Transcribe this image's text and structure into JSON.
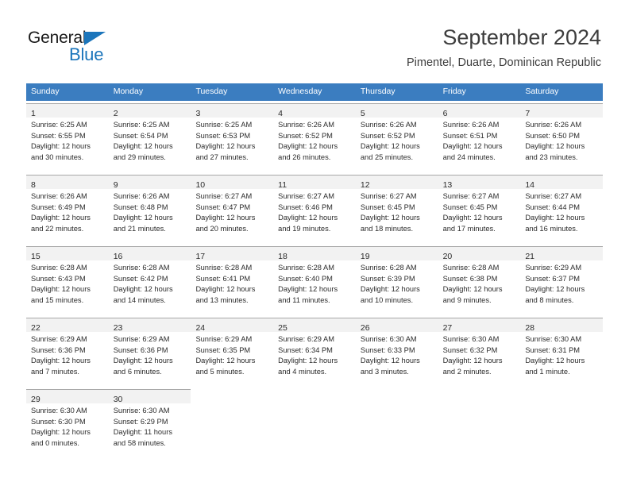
{
  "logo": {
    "word_dark": "General",
    "word_blue": "Blue",
    "accent_color": "#1b75bb"
  },
  "header": {
    "title": "September 2024",
    "subtitle": "Pimentel, Duarte, Dominican Republic"
  },
  "theme": {
    "weekday_header_bg": "#3b7dc0",
    "day_band_bg": "#f2f2f2",
    "cell_border": "#a8a8a8",
    "text_color": "#2b2b2b"
  },
  "weekdays": [
    "Sunday",
    "Monday",
    "Tuesday",
    "Wednesday",
    "Thursday",
    "Friday",
    "Saturday"
  ],
  "weeks": [
    [
      {
        "day": "1",
        "sunrise": "Sunrise: 6:25 AM",
        "sunset": "Sunset: 6:55 PM",
        "daylight_1": "Daylight: 12 hours",
        "daylight_2": "and 30 minutes."
      },
      {
        "day": "2",
        "sunrise": "Sunrise: 6:25 AM",
        "sunset": "Sunset: 6:54 PM",
        "daylight_1": "Daylight: 12 hours",
        "daylight_2": "and 29 minutes."
      },
      {
        "day": "3",
        "sunrise": "Sunrise: 6:25 AM",
        "sunset": "Sunset: 6:53 PM",
        "daylight_1": "Daylight: 12 hours",
        "daylight_2": "and 27 minutes."
      },
      {
        "day": "4",
        "sunrise": "Sunrise: 6:26 AM",
        "sunset": "Sunset: 6:52 PM",
        "daylight_1": "Daylight: 12 hours",
        "daylight_2": "and 26 minutes."
      },
      {
        "day": "5",
        "sunrise": "Sunrise: 6:26 AM",
        "sunset": "Sunset: 6:52 PM",
        "daylight_1": "Daylight: 12 hours",
        "daylight_2": "and 25 minutes."
      },
      {
        "day": "6",
        "sunrise": "Sunrise: 6:26 AM",
        "sunset": "Sunset: 6:51 PM",
        "daylight_1": "Daylight: 12 hours",
        "daylight_2": "and 24 minutes."
      },
      {
        "day": "7",
        "sunrise": "Sunrise: 6:26 AM",
        "sunset": "Sunset: 6:50 PM",
        "daylight_1": "Daylight: 12 hours",
        "daylight_2": "and 23 minutes."
      }
    ],
    [
      {
        "day": "8",
        "sunrise": "Sunrise: 6:26 AM",
        "sunset": "Sunset: 6:49 PM",
        "daylight_1": "Daylight: 12 hours",
        "daylight_2": "and 22 minutes."
      },
      {
        "day": "9",
        "sunrise": "Sunrise: 6:26 AM",
        "sunset": "Sunset: 6:48 PM",
        "daylight_1": "Daylight: 12 hours",
        "daylight_2": "and 21 minutes."
      },
      {
        "day": "10",
        "sunrise": "Sunrise: 6:27 AM",
        "sunset": "Sunset: 6:47 PM",
        "daylight_1": "Daylight: 12 hours",
        "daylight_2": "and 20 minutes."
      },
      {
        "day": "11",
        "sunrise": "Sunrise: 6:27 AM",
        "sunset": "Sunset: 6:46 PM",
        "daylight_1": "Daylight: 12 hours",
        "daylight_2": "and 19 minutes."
      },
      {
        "day": "12",
        "sunrise": "Sunrise: 6:27 AM",
        "sunset": "Sunset: 6:45 PM",
        "daylight_1": "Daylight: 12 hours",
        "daylight_2": "and 18 minutes."
      },
      {
        "day": "13",
        "sunrise": "Sunrise: 6:27 AM",
        "sunset": "Sunset: 6:45 PM",
        "daylight_1": "Daylight: 12 hours",
        "daylight_2": "and 17 minutes."
      },
      {
        "day": "14",
        "sunrise": "Sunrise: 6:27 AM",
        "sunset": "Sunset: 6:44 PM",
        "daylight_1": "Daylight: 12 hours",
        "daylight_2": "and 16 minutes."
      }
    ],
    [
      {
        "day": "15",
        "sunrise": "Sunrise: 6:28 AM",
        "sunset": "Sunset: 6:43 PM",
        "daylight_1": "Daylight: 12 hours",
        "daylight_2": "and 15 minutes."
      },
      {
        "day": "16",
        "sunrise": "Sunrise: 6:28 AM",
        "sunset": "Sunset: 6:42 PM",
        "daylight_1": "Daylight: 12 hours",
        "daylight_2": "and 14 minutes."
      },
      {
        "day": "17",
        "sunrise": "Sunrise: 6:28 AM",
        "sunset": "Sunset: 6:41 PM",
        "daylight_1": "Daylight: 12 hours",
        "daylight_2": "and 13 minutes."
      },
      {
        "day": "18",
        "sunrise": "Sunrise: 6:28 AM",
        "sunset": "Sunset: 6:40 PM",
        "daylight_1": "Daylight: 12 hours",
        "daylight_2": "and 11 minutes."
      },
      {
        "day": "19",
        "sunrise": "Sunrise: 6:28 AM",
        "sunset": "Sunset: 6:39 PM",
        "daylight_1": "Daylight: 12 hours",
        "daylight_2": "and 10 minutes."
      },
      {
        "day": "20",
        "sunrise": "Sunrise: 6:28 AM",
        "sunset": "Sunset: 6:38 PM",
        "daylight_1": "Daylight: 12 hours",
        "daylight_2": "and 9 minutes."
      },
      {
        "day": "21",
        "sunrise": "Sunrise: 6:29 AM",
        "sunset": "Sunset: 6:37 PM",
        "daylight_1": "Daylight: 12 hours",
        "daylight_2": "and 8 minutes."
      }
    ],
    [
      {
        "day": "22",
        "sunrise": "Sunrise: 6:29 AM",
        "sunset": "Sunset: 6:36 PM",
        "daylight_1": "Daylight: 12 hours",
        "daylight_2": "and 7 minutes."
      },
      {
        "day": "23",
        "sunrise": "Sunrise: 6:29 AM",
        "sunset": "Sunset: 6:36 PM",
        "daylight_1": "Daylight: 12 hours",
        "daylight_2": "and 6 minutes."
      },
      {
        "day": "24",
        "sunrise": "Sunrise: 6:29 AM",
        "sunset": "Sunset: 6:35 PM",
        "daylight_1": "Daylight: 12 hours",
        "daylight_2": "and 5 minutes."
      },
      {
        "day": "25",
        "sunrise": "Sunrise: 6:29 AM",
        "sunset": "Sunset: 6:34 PM",
        "daylight_1": "Daylight: 12 hours",
        "daylight_2": "and 4 minutes."
      },
      {
        "day": "26",
        "sunrise": "Sunrise: 6:30 AM",
        "sunset": "Sunset: 6:33 PM",
        "daylight_1": "Daylight: 12 hours",
        "daylight_2": "and 3 minutes."
      },
      {
        "day": "27",
        "sunrise": "Sunrise: 6:30 AM",
        "sunset": "Sunset: 6:32 PM",
        "daylight_1": "Daylight: 12 hours",
        "daylight_2": "and 2 minutes."
      },
      {
        "day": "28",
        "sunrise": "Sunrise: 6:30 AM",
        "sunset": "Sunset: 6:31 PM",
        "daylight_1": "Daylight: 12 hours",
        "daylight_2": "and 1 minute."
      }
    ],
    [
      {
        "day": "29",
        "sunrise": "Sunrise: 6:30 AM",
        "sunset": "Sunset: 6:30 PM",
        "daylight_1": "Daylight: 12 hours",
        "daylight_2": "and 0 minutes."
      },
      {
        "day": "30",
        "sunrise": "Sunrise: 6:30 AM",
        "sunset": "Sunset: 6:29 PM",
        "daylight_1": "Daylight: 11 hours",
        "daylight_2": "and 58 minutes."
      },
      null,
      null,
      null,
      null,
      null
    ]
  ]
}
